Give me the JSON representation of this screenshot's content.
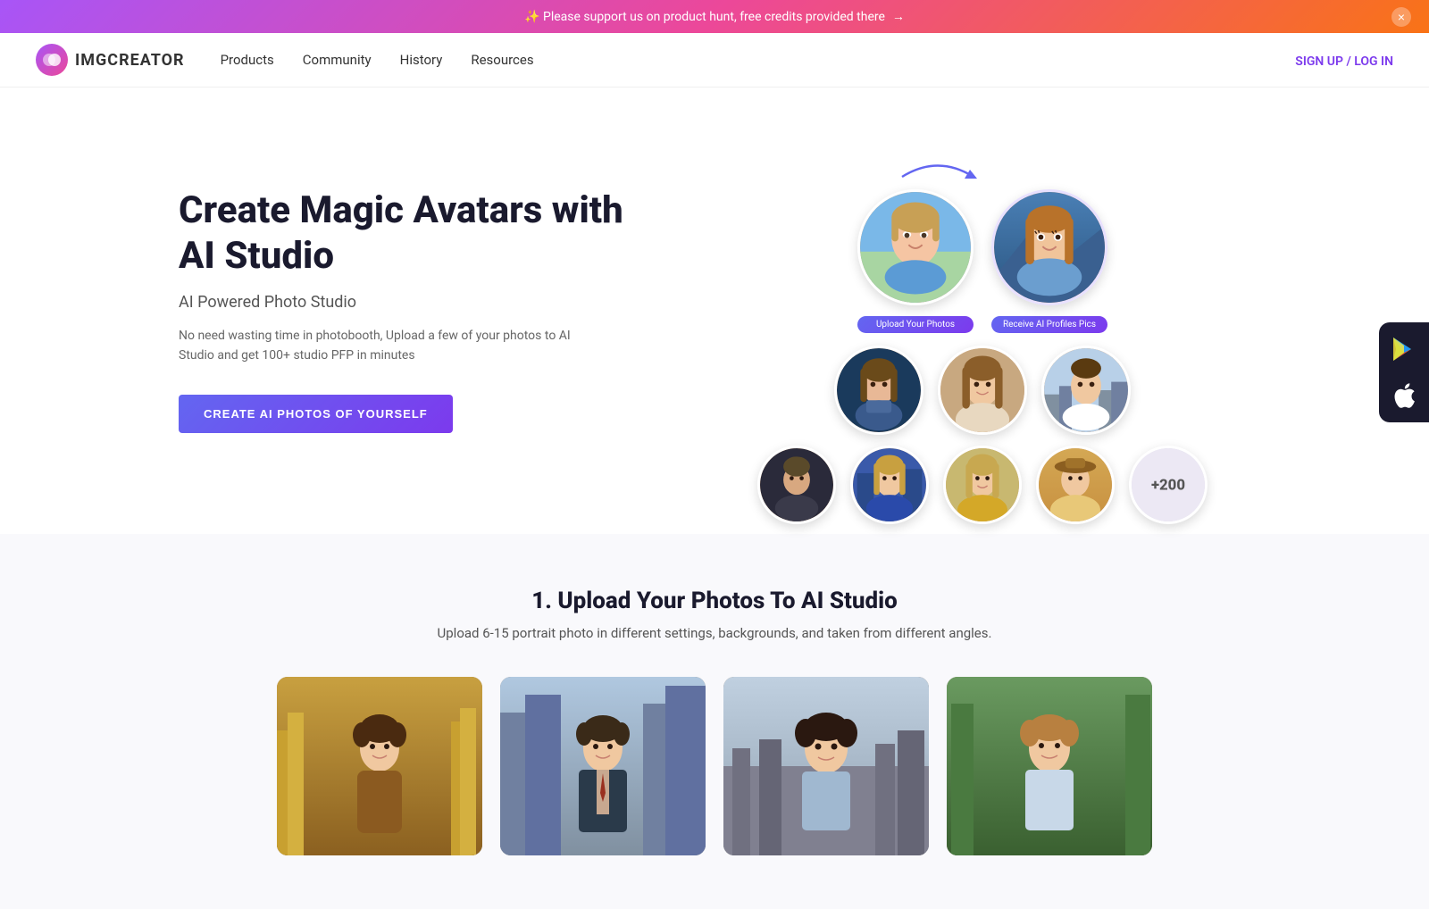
{
  "banner": {
    "text": "✨ Please support us on product hunt, free credits provided there",
    "arrow": "→",
    "close_label": "×"
  },
  "navbar": {
    "logo_text": "IMGCREATOR",
    "links": [
      {
        "id": "products",
        "label": "Products"
      },
      {
        "id": "community",
        "label": "Community"
      },
      {
        "id": "history",
        "label": "History"
      },
      {
        "id": "resources",
        "label": "Resources"
      }
    ],
    "auth_label": "SIGN UP / LOG IN"
  },
  "hero": {
    "title": "Create Magic Avatars with AI Studio",
    "subtitle": "AI Powered Photo Studio",
    "description": "No need wasting time in photobooth, Upload a few of your photos to AI Studio and get 100+ studio PFP in minutes",
    "cta_label": "CREATE AI PHOTOS OF YOURSELF",
    "upload_label": "Upload Your Photos",
    "receive_label": "Receive AI Profiles Pics",
    "plus_label": "+200"
  },
  "how_it_works": {
    "title": "1. Upload Your Photos To AI Studio",
    "description": "Upload 6-15 portrait photo in different settings, backgrounds, and taken from different angles."
  },
  "app_store": {
    "google_play_label": "▶",
    "apple_label": ""
  }
}
